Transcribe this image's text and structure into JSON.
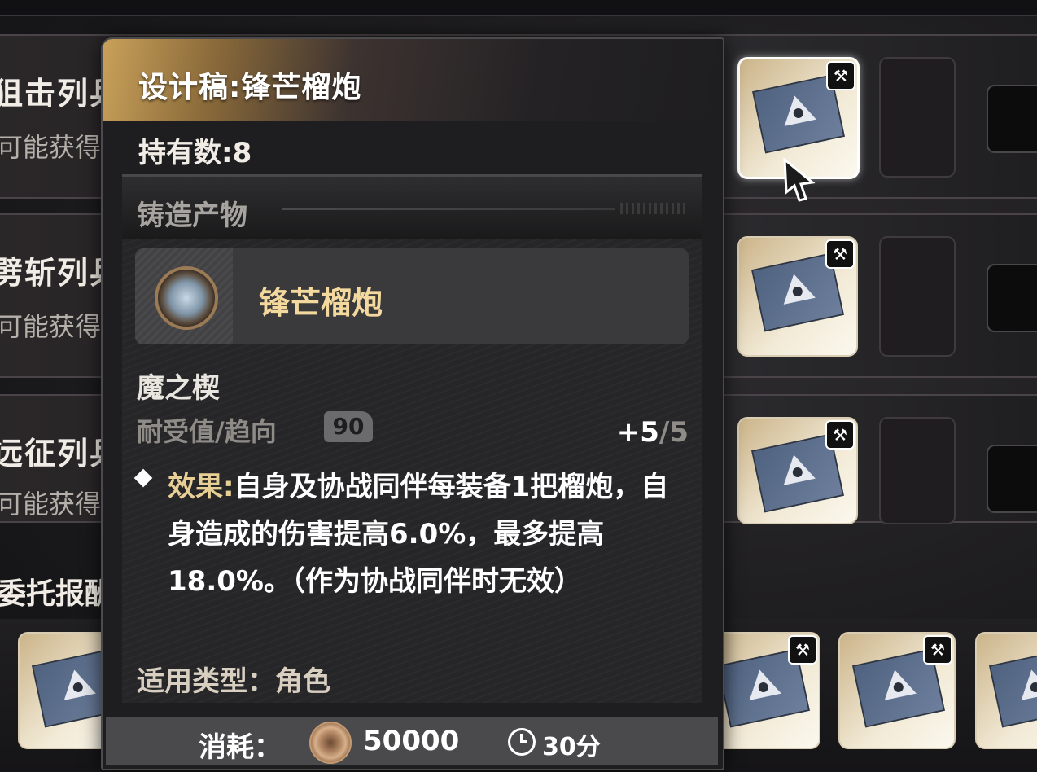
{
  "background": {
    "rows": [
      {
        "name": "狙击列兵",
        "sub": "可能获得"
      },
      {
        "name": "劈斩列兵",
        "sub": "可能获得"
      },
      {
        "name": "远征列兵",
        "sub": "可能获得"
      }
    ],
    "reward_title": "委托报酬"
  },
  "tooltip": {
    "title": "设计稿:锋芒榴炮",
    "hold_label": "持有数:",
    "hold_count": "8",
    "section_label": "铸造产物",
    "product_name": "锋芒榴炮",
    "set_name": "魔之楔",
    "tolerance_label": "耐受值/趋向",
    "tolerance_value": "90",
    "level_current": "+5",
    "level_separator": "/",
    "level_max": "5",
    "effect_label": "效果:",
    "effect_text": "自身及协战同伴每装备1把榴炮，自身造成的伤害提高6.0%，最多提高18.0%。（作为协战同伴时无效）",
    "apply_label": "适用类型：",
    "apply_value": "角色",
    "cost_label": "消耗：",
    "cost_value": "50000",
    "time_value": "30分"
  },
  "icons": {
    "hammer": "hammer-icon",
    "clock": "clock-icon",
    "coin": "coin-icon"
  }
}
